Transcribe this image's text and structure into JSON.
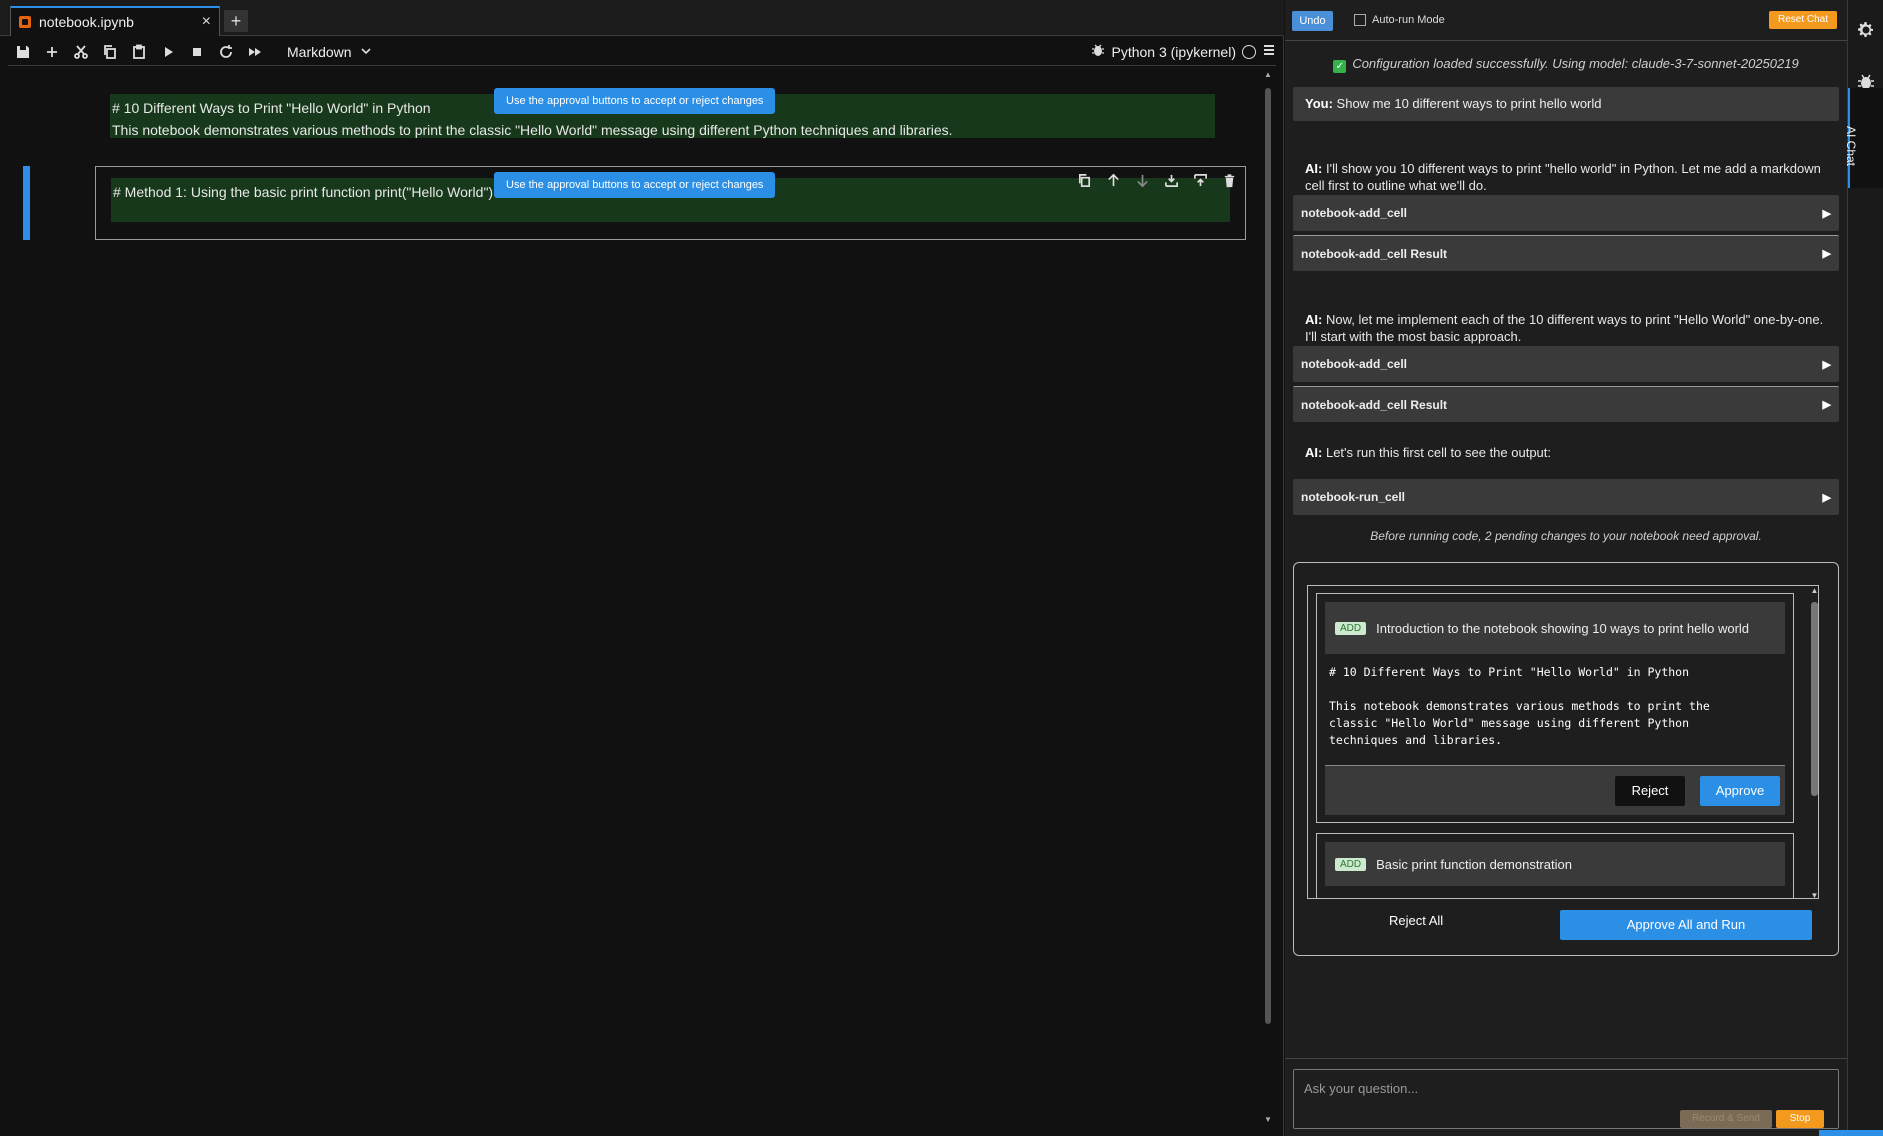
{
  "notebook": {
    "tab_name": "notebook.ipynb",
    "new_tab_label": "+",
    "cell_type": "Markdown",
    "kernel_name": "Python 3 (ipykernel)",
    "approval_tip": "Use the approval buttons to accept or reject changes",
    "cells": [
      {
        "line1": "# 10 Different Ways to Print \"Hello World\" in Python",
        "line2": "This notebook demonstrates various methods to print the classic \"Hello World\" message using different Python techniques and libraries."
      },
      {
        "line1": "# Method 1: Using the basic print function",
        "line2": "print(\"Hello World\")"
      }
    ]
  },
  "chat": {
    "undo_label": "Undo",
    "auto_run_label": "Auto-run Mode",
    "reset_label": "Reset Chat",
    "config_msg": "Configuration loaded successfully. Using model: claude-3-7-sonnet-20250219",
    "user_prefix": "You:",
    "user_msg": "Show me 10 different ways to print hello world",
    "ai_prefix": "AI:",
    "ai_msgs": [
      "I'll show you 10 different ways to print \"hello world\" in Python. Let me add a markdown cell first to outline what we'll do.",
      "Now, let me implement each of the 10 different ways to print \"Hello World\" one-by-one. I'll start with the most basic approach.",
      "Let's run this first cell to see the output:"
    ],
    "tools": [
      "notebook-add_cell",
      "notebook-add_cell Result",
      "notebook-add_cell",
      "notebook-add_cell Result",
      "notebook-run_cell"
    ],
    "pending_note": "Before running code, 2 pending changes to your notebook need approval.",
    "changes": [
      {
        "badge": "ADD",
        "title": "Introduction to the notebook showing 10 ways to print hello world",
        "code": "# 10 Different Ways to Print \"Hello World\" in Python\n\nThis notebook demonstrates various methods to print the\nclassic \"Hello World\" message using different Python\ntechniques and libraries.",
        "reject_label": "Reject",
        "approve_label": "Approve"
      },
      {
        "badge": "ADD",
        "title": "Basic print function demonstration"
      }
    ],
    "reject_all_label": "Reject All",
    "approve_all_label": "Approve All and Run",
    "input_placeholder": "Ask your question...",
    "record_label": "Record & Send",
    "stop_label": "Stop"
  },
  "sidebar": {
    "ai_chat_label": "AI Chat"
  },
  "icons": {
    "tab_icon": "notebook-icon",
    "toolbar": [
      "save-icon",
      "add-cell-icon",
      "cut-icon",
      "copy-icon",
      "paste-icon",
      "run-icon",
      "stop-icon",
      "restart-icon",
      "run-all-icon"
    ],
    "rail": [
      "gear-icon",
      "bug-icon"
    ]
  },
  "colors": {
    "accent": "#2b8fe6",
    "warning": "#f39a1e",
    "added_cell_bg": "#17381a",
    "add_badge": "#cde9cf"
  }
}
